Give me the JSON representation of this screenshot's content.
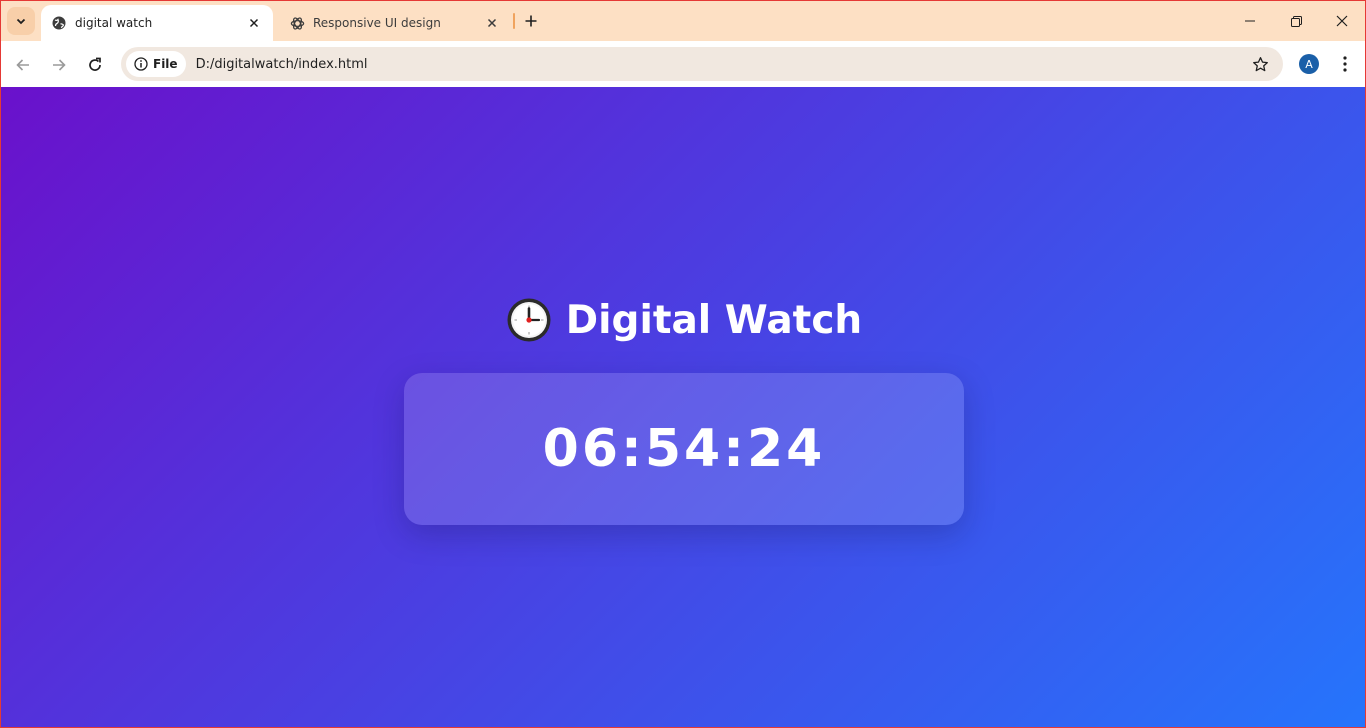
{
  "browser": {
    "tabs": [
      {
        "title": "digital watch",
        "active": true,
        "favicon": "globe-icon"
      },
      {
        "title": "Responsive UI design",
        "active": false,
        "favicon": "openai-icon"
      }
    ],
    "address": {
      "chip_label": "File",
      "url": "D:/digitalwatch/index.html"
    },
    "profile_initial": "A"
  },
  "page": {
    "heading": "Digital Watch",
    "heading_icon": "clock-emoji-icon",
    "time": "06:54:24"
  },
  "colors": {
    "gradient_start": "#6a11cb",
    "gradient_end": "#2575fc",
    "tab_strip": "#fde0c4",
    "avatar": "#1a5fa8"
  }
}
